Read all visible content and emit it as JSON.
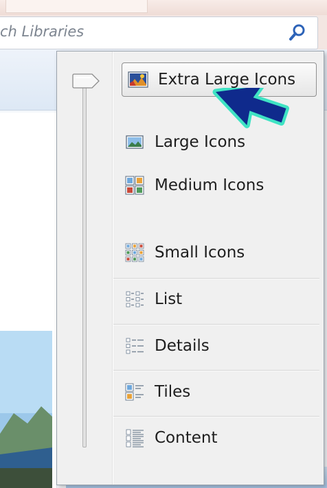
{
  "search": {
    "placeholder_text": "ch Libraries",
    "icon": "magnifier-icon"
  },
  "view_menu": {
    "slider_icon": "slider-thumb",
    "items": [
      {
        "label": "Extra Large Icons",
        "icon": "extra-large-icons-icon",
        "selected": true
      },
      {
        "label": "Large Icons",
        "icon": "large-icons-icon",
        "selected": false
      },
      {
        "label": "Medium Icons",
        "icon": "medium-icons-icon",
        "selected": false
      },
      {
        "label": "Small Icons",
        "icon": "small-icons-icon",
        "selected": false
      },
      {
        "label": "List",
        "icon": "list-view-icon",
        "selected": false
      },
      {
        "label": "Details",
        "icon": "details-view-icon",
        "selected": false
      },
      {
        "label": "Tiles",
        "icon": "tiles-view-icon",
        "selected": false
      },
      {
        "label": "Content",
        "icon": "content-view-icon",
        "selected": false
      }
    ]
  },
  "colors": {
    "pointer_fill": "#0f2a8c",
    "pointer_outline": "#3fe3c4",
    "selection_border": "#8f8f8f"
  }
}
